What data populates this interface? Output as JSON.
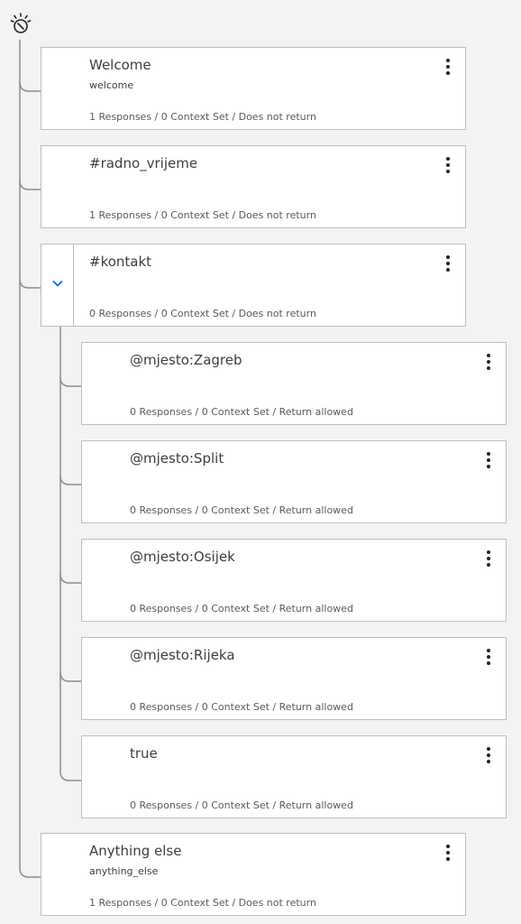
{
  "colors": {
    "background": "#f3f3f3",
    "card": "#ffffff",
    "border": "#bdbdbd",
    "line": "#8c8c8c",
    "chevron": "#0f62fe"
  },
  "root": {
    "icon": "ibm-watson-icon"
  },
  "nodes": [
    {
      "title": "Welcome",
      "subtitle": "welcome",
      "footer": "1 Responses / 0 Context Set / Does not return"
    },
    {
      "title": "#radno_vrijeme",
      "subtitle": "",
      "footer": "1 Responses / 0 Context Set / Does not return"
    },
    {
      "title": "#kontakt",
      "subtitle": "",
      "footer": "0 Responses / 0 Context Set / Does not return",
      "expanded": true
    },
    {
      "title": "@mjesto:Zagreb",
      "subtitle": "",
      "footer": "0 Responses / 0 Context Set / Return allowed"
    },
    {
      "title": "@mjesto:Split",
      "subtitle": "",
      "footer": "0 Responses / 0 Context Set / Return allowed"
    },
    {
      "title": "@mjesto:Osijek",
      "subtitle": "",
      "footer": "0 Responses / 0 Context Set / Return allowed"
    },
    {
      "title": "@mjesto:Rijeka",
      "subtitle": "",
      "footer": "0 Responses / 0 Context Set / Return allowed"
    },
    {
      "title": "true",
      "subtitle": "",
      "footer": "0 Responses / 0 Context Set / Return allowed"
    },
    {
      "title": "Anything else",
      "subtitle": "anything_else",
      "footer": "1 Responses / 0 Context Set / Does not return"
    }
  ]
}
